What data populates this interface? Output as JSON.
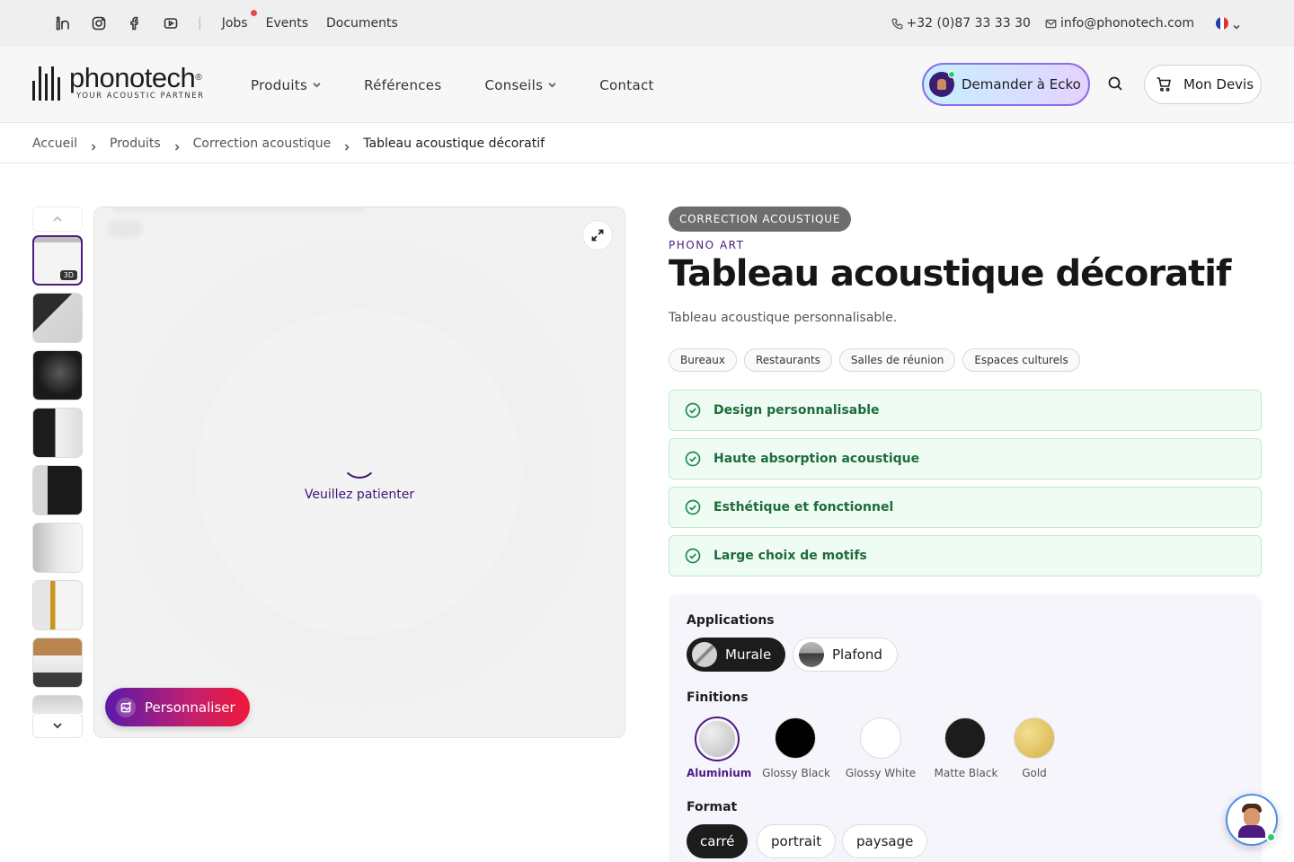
{
  "topbar": {
    "social_icons": [
      "linkedin-icon",
      "instagram-icon",
      "facebook-icon",
      "youtube-icon"
    ],
    "separator": "|",
    "links": [
      "Jobs",
      "Events",
      "Documents"
    ],
    "phone": "+32 (0)87 33 33 30",
    "email": "info@phonotech.com",
    "language_flag": "fr-flag-icon"
  },
  "header": {
    "logo_brand": "phonotech",
    "logo_registered": "®",
    "logo_tagline": "YOUR ACOUSTIC PARTNER",
    "nav": [
      {
        "label": "Produits",
        "has_dropdown": true
      },
      {
        "label": "Références",
        "has_dropdown": false
      },
      {
        "label": "Conseils",
        "has_dropdown": true
      },
      {
        "label": "Contact",
        "has_dropdown": false
      }
    ],
    "ask_ecko_label": "Demander à Ecko",
    "devis_label": "Mon Devis"
  },
  "breadcrumb": [
    "Accueil",
    "Produits",
    "Correction acoustique",
    "Tableau acoustique décoratif"
  ],
  "gallery": {
    "badge_3d": "3D",
    "loading_text": "Veuillez patienter",
    "customize_label": "Personnaliser"
  },
  "product": {
    "category": "CORRECTION ACOUSTIQUE",
    "brand": "PHONO ART",
    "title": "Tableau acoustique décoratif",
    "subtitle": "Tableau acoustique personnalisable.",
    "tags": [
      "Bureaux",
      "Restaurants",
      "Salles de réunion",
      "Espaces culturels"
    ],
    "features": [
      "Design personnalisable",
      "Haute absorption acoustique",
      "Esthétique et fonctionnel",
      "Large choix de motifs"
    ]
  },
  "config": {
    "applications_title": "Applications",
    "applications": [
      {
        "label": "Murale",
        "selected": true
      },
      {
        "label": "Plafond",
        "selected": false
      }
    ],
    "finitions_title": "Finitions",
    "finitions": [
      {
        "label": "Aluminium",
        "color": "#c9c9c9",
        "selected": true
      },
      {
        "label": "Glossy Black",
        "color": "#000000",
        "selected": false
      },
      {
        "label": "Glossy White",
        "color": "#ffffff",
        "selected": false
      },
      {
        "label": "Matte Black",
        "color": "#1c1c1c",
        "selected": false
      },
      {
        "label": "Gold",
        "color": "#e3c25a",
        "selected": false
      }
    ],
    "format_title": "Format",
    "formats": [
      {
        "label": "carré",
        "selected": true
      },
      {
        "label": "portrait",
        "selected": false
      },
      {
        "label": "paysage",
        "selected": false
      }
    ]
  },
  "colors": {
    "accent_purple": "#4b1a82",
    "feature_green": "#1e6b3c",
    "feature_bg": "#effcf3"
  }
}
